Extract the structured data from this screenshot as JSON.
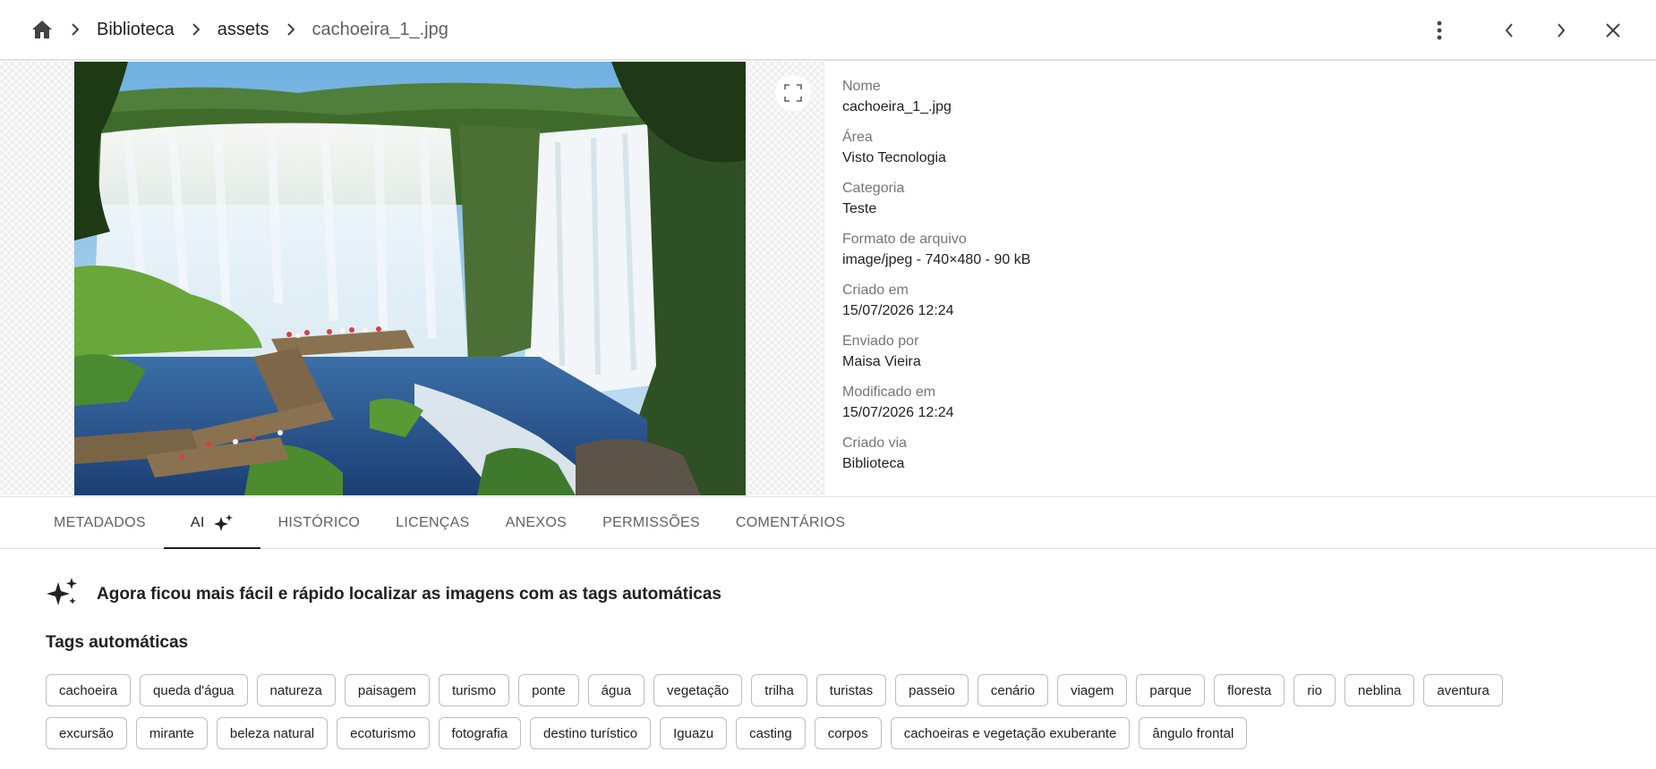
{
  "breadcrumb": {
    "items": [
      "Biblioteca",
      "assets"
    ],
    "current": "cachoeira_1_.jpg"
  },
  "info": [
    {
      "label": "Nome",
      "value": "cachoeira_1_.jpg"
    },
    {
      "label": "Área",
      "value": "Visto Tecnologia"
    },
    {
      "label": "Categoria",
      "value": "Teste"
    },
    {
      "label": "Formato de arquivo",
      "value": "image/jpeg - 740×480 - 90 kB"
    },
    {
      "label": "Criado em",
      "value": "15/07/2026 12:24"
    },
    {
      "label": "Enviado por",
      "value": "Maisa Vieira"
    },
    {
      "label": "Modificado em",
      "value": "15/07/2026 12:24"
    },
    {
      "label": "Criado via",
      "value": "Biblioteca"
    }
  ],
  "tabs": [
    "METADADOS",
    "AI",
    "HISTÓRICO",
    "LICENÇAS",
    "ANEXOS",
    "PERMISSÕES",
    "COMENTÁRIOS"
  ],
  "active_tab": "AI",
  "ai": {
    "banner": "Agora ficou mais fácil e rápido localizar as imagens com as tags automáticas",
    "tags_title": "Tags automáticas",
    "tags": [
      "cachoeira",
      "queda d'água",
      "natureza",
      "paisagem",
      "turismo",
      "ponte",
      "água",
      "vegetação",
      "trilha",
      "turistas",
      "passeio",
      "cenário",
      "viagem",
      "parque",
      "floresta",
      "rio",
      "neblina",
      "aventura",
      "excursão",
      "mirante",
      "beleza natural",
      "ecoturismo",
      "fotografia",
      "destino turístico",
      "Iguazu",
      "casting",
      "corpos",
      "cachoeiras e vegetação exuberante",
      "ângulo frontal"
    ]
  },
  "icons": [
    "home-icon",
    "chevron-right-icon",
    "more-vert-icon",
    "chevron-left-icon",
    "close-icon",
    "fullscreen-icon",
    "sparkles-icon"
  ],
  "colors": {
    "text": "#212121",
    "muted": "#757575",
    "border": "#bdbdbd",
    "accent": "#212121"
  }
}
